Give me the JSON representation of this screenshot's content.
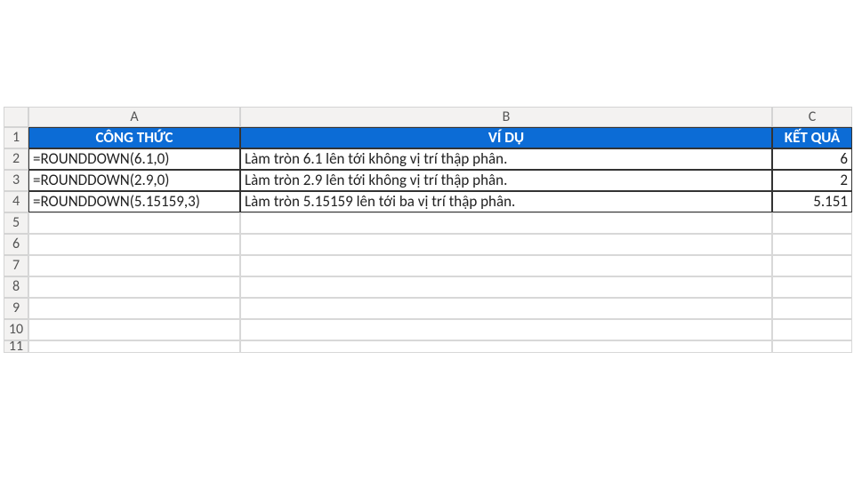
{
  "columns": {
    "A": "A",
    "B": "B",
    "C": "C"
  },
  "rows": [
    "1",
    "2",
    "3",
    "4",
    "5",
    "6",
    "7",
    "8",
    "9",
    "10",
    "11"
  ],
  "header": {
    "colA": "CÔNG THỨC",
    "colB": "VÍ DỤ",
    "colC": "KẾT QUẢ"
  },
  "data": [
    {
      "formula": "=ROUNDDOWN(6.1,0)",
      "example": "Làm tròn 6.1 lên tới không vị trí thập phân.",
      "result": "6"
    },
    {
      "formula": "=ROUNDDOWN(2.9,0)",
      "example": "Làm tròn 2.9 lên tới không vị trí thập phân.",
      "result": "2"
    },
    {
      "formula": "=ROUNDDOWN(5.15159,3)",
      "example": "Làm tròn 5.15159 lên tới ba vị trí thập phân.",
      "result": "5.151"
    }
  ]
}
